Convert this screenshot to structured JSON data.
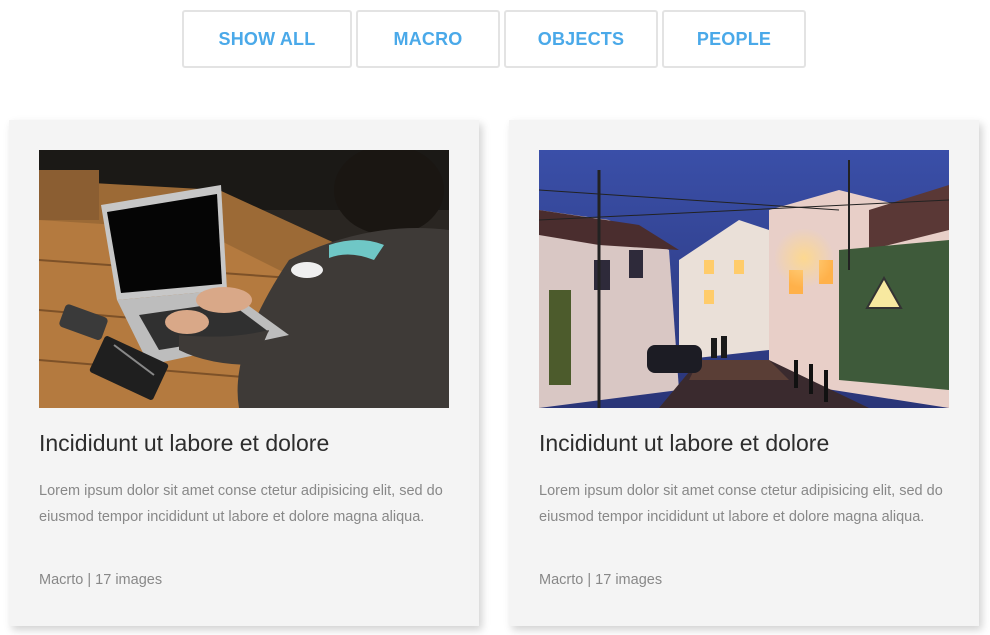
{
  "filters": {
    "show_all": "SHOW ALL",
    "macro": "MACRO",
    "objects": "OBJECTS",
    "people": "PEOPLE"
  },
  "cards": [
    {
      "title": "Incididunt ut labore et dolore",
      "description": "Lorem ipsum dolor sit amet conse ctetur adipisicing elit, sed do eiusmod tempor incididunt ut labore et dolore magna aliqua.",
      "category": "Macrto",
      "separator": "|",
      "count": "17 images"
    },
    {
      "title": "Incididunt ut labore et dolore",
      "description": "Lorem ipsum dolor sit amet conse ctetur adipisicing elit, sed do eiusmod tempor incididunt ut labore et dolore magna aliqua.",
      "category": "Macrto",
      "separator": "|",
      "count": "17 images"
    }
  ],
  "colors": {
    "accent": "#4aa9e9",
    "card_bg": "#f4f4f4",
    "title": "#2d2d2d",
    "muted": "#888888"
  }
}
